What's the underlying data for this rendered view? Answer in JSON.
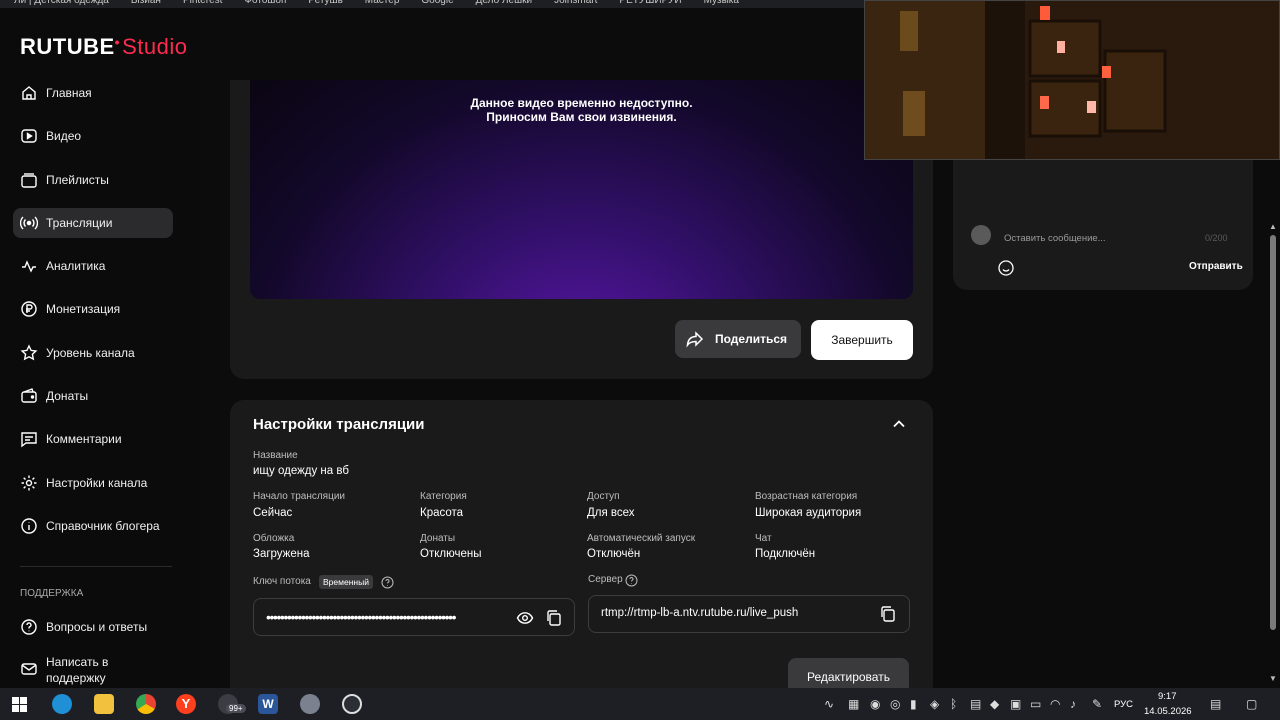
{
  "browser": {
    "bookmarks": [
      "Ли | Детская одежда",
      "Ызиан",
      "Pinterest",
      "Фотошоп",
      "Ретушь",
      "Мастер",
      "Google",
      "Дело Лёшки",
      "Joinsmart",
      "РЕТУШИРУЙ",
      "Музыка"
    ]
  },
  "sidebar": {
    "logo_main": "RUTUBE",
    "logo_sub": "Studio",
    "items": [
      {
        "label": "Главная"
      },
      {
        "label": "Видео"
      },
      {
        "label": "Плейлисты"
      },
      {
        "label": "Трансляции"
      },
      {
        "label": "Аналитика"
      },
      {
        "label": "Монетизация"
      },
      {
        "label": "Уровень канала"
      },
      {
        "label": "Донаты"
      },
      {
        "label": "Комментарии"
      },
      {
        "label": "Настройки канала"
      },
      {
        "label": "Справочник блогера"
      }
    ],
    "support_title": "ПОДДЕРЖКА",
    "support_items": [
      {
        "label": "Вопросы и ответы"
      },
      {
        "label": "Написать в поддержку"
      }
    ]
  },
  "player": {
    "message_line1": "Данное видео временно недоступно.",
    "message_line2": "Приносим Вам свои извинения.",
    "share_label": "Поделиться",
    "end_label": "Завершить"
  },
  "settings": {
    "title": "Настройки трансляции",
    "name_label": "Название",
    "name_value": "ищу одежду на вб",
    "start_label": "Начало трансляции",
    "start_value": "Сейчас",
    "category_label": "Категория",
    "category_value": "Красота",
    "access_label": "Доступ",
    "access_value": "Для всех",
    "age_label": "Возрастная категория",
    "age_value": "Широкая аудитория",
    "cover_label": "Обложка",
    "cover_value": "Загружена",
    "donates_label": "Донаты",
    "donates_value": "Отключены",
    "autostart_label": "Автоматический запуск",
    "autostart_value": "Отключён",
    "chat_label": "Чат",
    "chat_value": "Подключён",
    "key_label": "Ключ потока",
    "key_badge": "Временный",
    "key_masked": "••••••••••••••••••••••••••••••••••••••••••••••••••••••",
    "server_label": "Сервер",
    "server_value": "rtmp://rtmp-lb-a.ntv.rutube.ru/live_push",
    "edit_label": "Редактировать"
  },
  "chat": {
    "placeholder": "Оставить сообщение...",
    "counter": "0/200",
    "send_label": "Отправить"
  },
  "taskbar": {
    "badge": "99+",
    "lang": "РУС",
    "time": "9:17",
    "date": "14.05.2026"
  },
  "colors": {
    "brand": "#ff2b4e",
    "panel": "#1a1a1b",
    "video_purple": "#5b16a8"
  }
}
